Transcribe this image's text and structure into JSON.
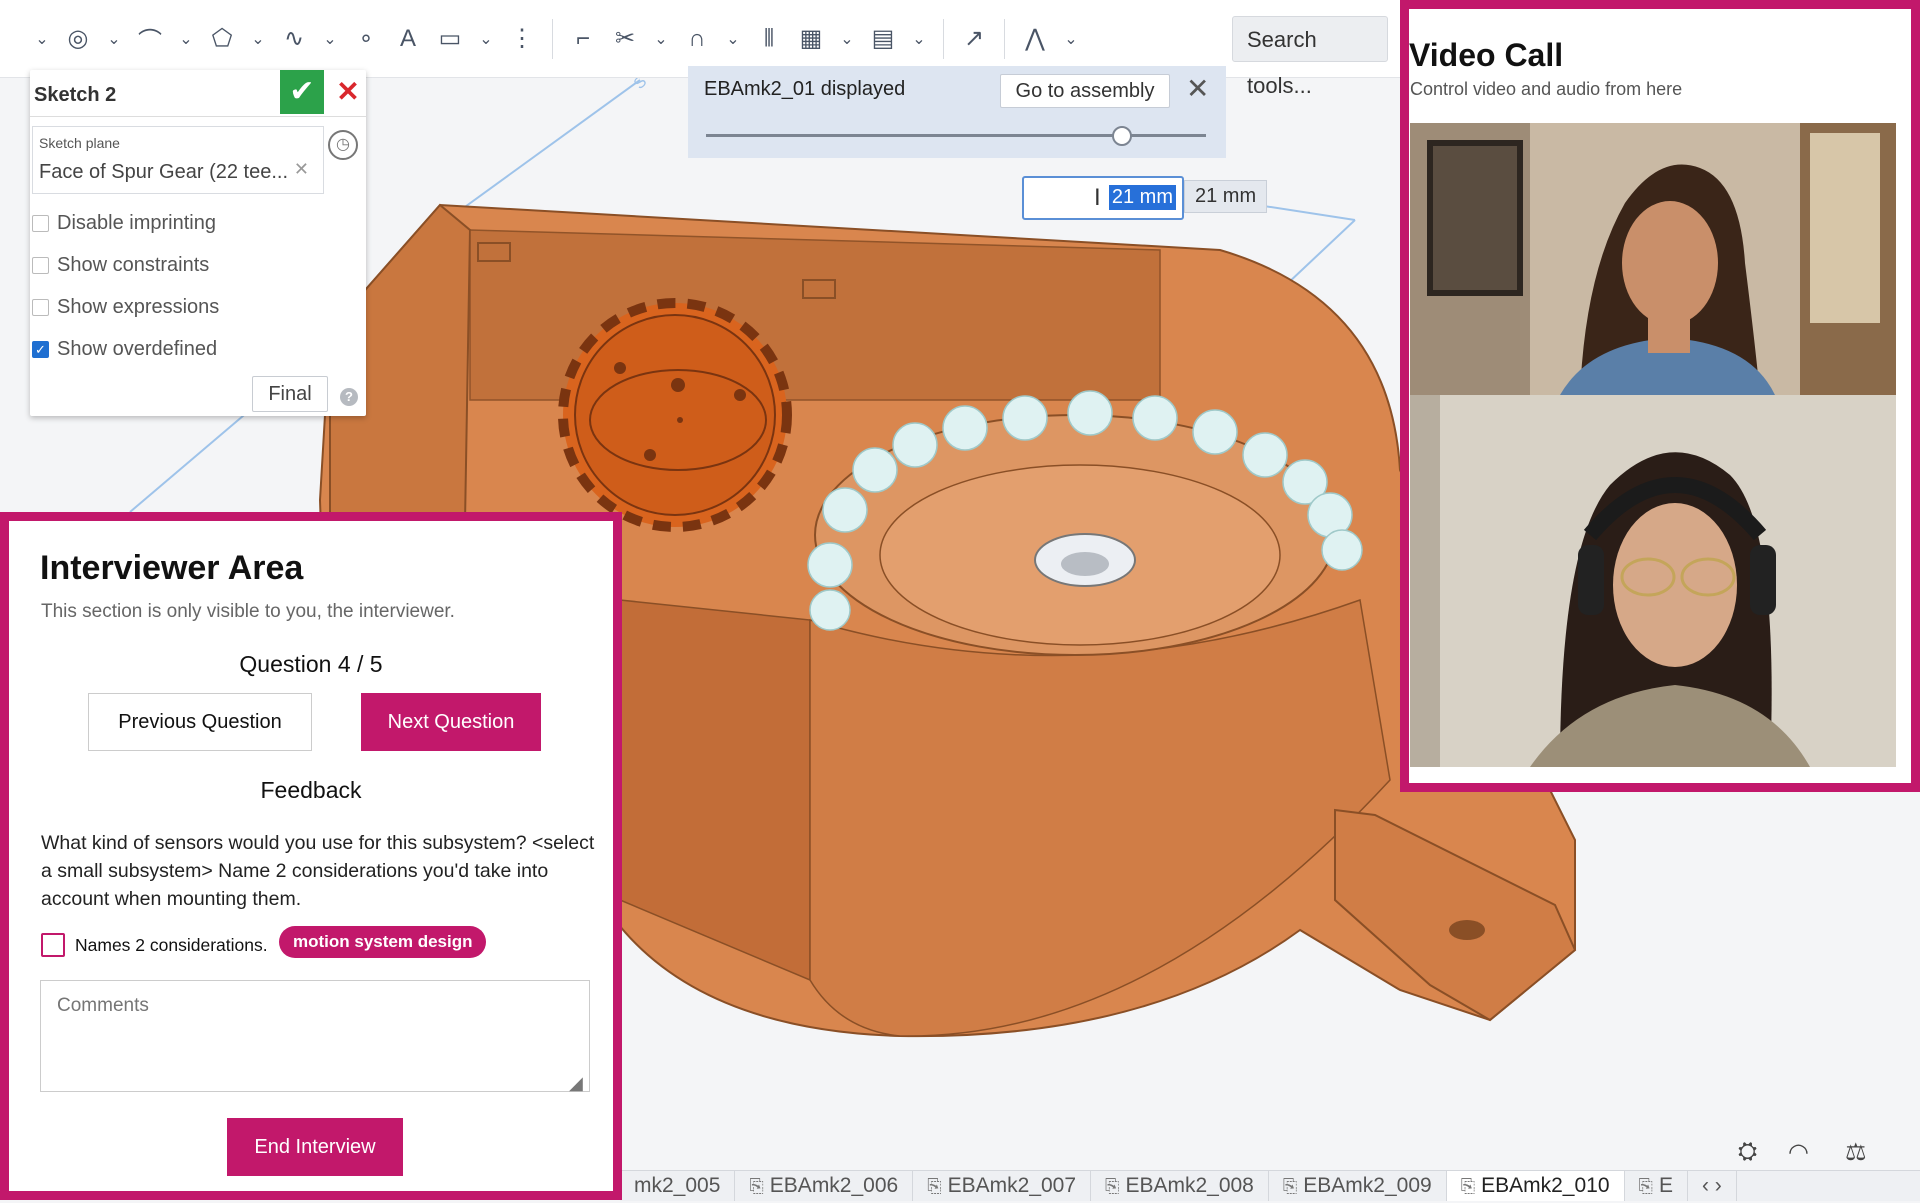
{
  "toolbar": {
    "search_placeholder": "Search tools..."
  },
  "sketch_panel": {
    "title": "Sketch 2",
    "plane_label": "Sketch plane",
    "plane_value": "Face of Spur Gear (22 tee...",
    "options": [
      {
        "label": "Disable imprinting",
        "checked": false
      },
      {
        "label": "Show constraints",
        "checked": false
      },
      {
        "label": "Show expressions",
        "checked": false
      },
      {
        "label": "Show overdefined",
        "checked": true
      }
    ],
    "final_label": "Final"
  },
  "version_bar": {
    "text": "EBAmk2_01 displayed",
    "goto_label": "Go to assembly",
    "slider_fraction": 0.83
  },
  "dimension": {
    "input_value": "21 mm",
    "label": "21 mm"
  },
  "tabs": [
    {
      "label": "mk2_005",
      "active": false
    },
    {
      "label": "EBAmk2_006",
      "active": false
    },
    {
      "label": "EBAmk2_007",
      "active": false
    },
    {
      "label": "EBAmk2_008",
      "active": false
    },
    {
      "label": "EBAmk2_009",
      "active": false
    },
    {
      "label": "EBAmk2_010",
      "active": true
    },
    {
      "label": "E",
      "active": false
    }
  ],
  "interviewer": {
    "title": "Interviewer Area",
    "subtitle": "This section is only visible to you, the interviewer.",
    "question_counter": "Question 4 / 5",
    "prev_label": "Previous Question",
    "next_label": "Next Question",
    "feedback_heading": "Feedback",
    "question_text": "What kind of sensors would you use for this subsystem? <select a small subsystem> Name 2 considerations you'd take into account when mounting them.",
    "criteria_label": "Names 2 considerations.",
    "criteria_tag": "motion system design",
    "comments_placeholder": "Comments",
    "end_label": "End Interview"
  },
  "video_call": {
    "title": "Video Call",
    "subtitle": "Control video and audio from here"
  },
  "colors": {
    "accent": "#c2186b",
    "part": "#d9864e",
    "gear": "#d9641e",
    "confirm": "#2ca24a",
    "cancel": "#d9272d"
  }
}
